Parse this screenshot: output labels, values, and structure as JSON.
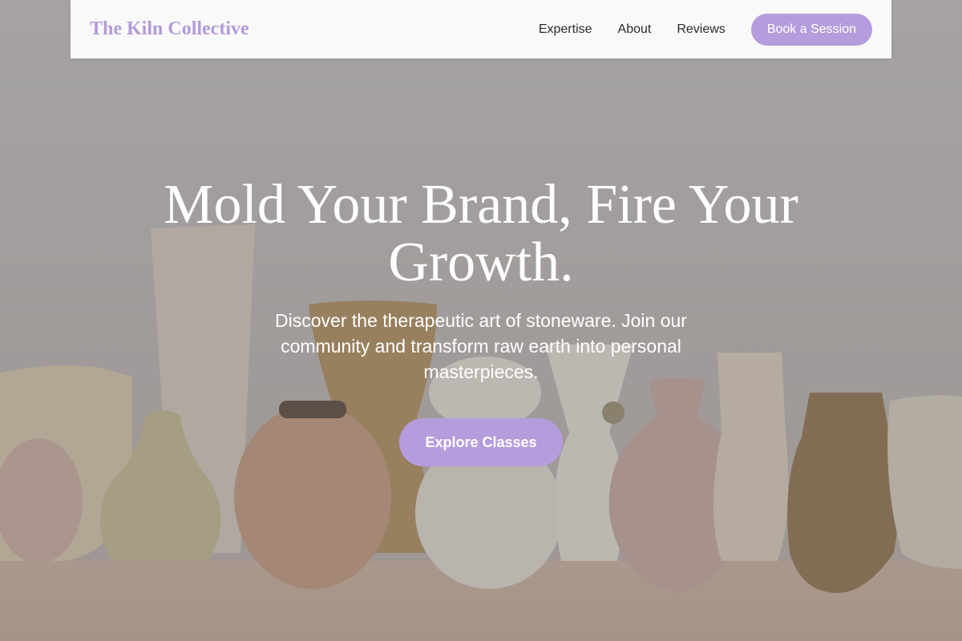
{
  "nav": {
    "brand": "The Kiln Collective",
    "links": [
      {
        "label": "Expertise"
      },
      {
        "label": "About"
      },
      {
        "label": "Reviews"
      }
    ],
    "cta_label": "Book a Session"
  },
  "hero": {
    "title": "Mold Your Brand, Fire Your Growth.",
    "subtitle": "Discover the therapeutic art of stoneware. Join our community and transform raw earth into personal masterpieces.",
    "cta_label": "Explore Classes",
    "background_image": "stoneware-vases-photo"
  },
  "colors": {
    "accent": "#b59ddd",
    "brand_text": "#b49ad8",
    "nav_background": "#f9f9f9"
  }
}
